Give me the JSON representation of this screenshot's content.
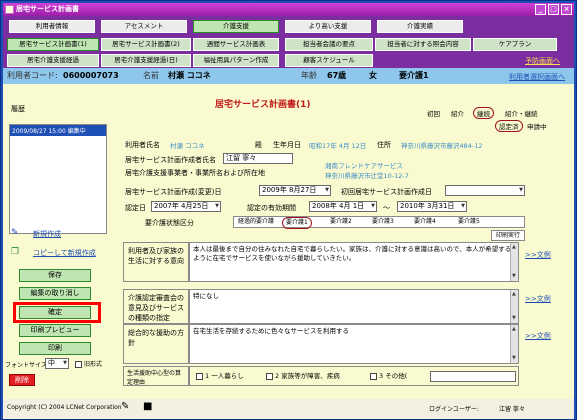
{
  "window": {
    "title": "居宅サービス計画書"
  },
  "nav_row1": [
    "利用者情報",
    "アセスメント",
    "介護支援",
    "より高い支援",
    "介護実績"
  ],
  "nav_row2": [
    "居宅サービス計画書(1)",
    "居宅サービス計画書(2)",
    "週間サービス計画表",
    "担当者会議の要点",
    "担当者に対する照会内容",
    "ケアプラン"
  ],
  "nav_row3": [
    "居宅介護支援経過",
    "居宅介護支援経過(日)",
    "福祉用具パターン作成",
    "顧客スケジュール"
  ],
  "nav_links": {
    "prev_screen": "予防画面へ",
    "user_select": "利用者選択画面へ"
  },
  "info": {
    "code_label": "利用者コード:",
    "code": "0600007073",
    "name_label": "名前",
    "name": "村瀬 ココネ",
    "age_label": "年齢",
    "age": "67歳",
    "sex": "女",
    "care_level": "要介護1"
  },
  "doc_title": "居宅サービス計画書(1)",
  "sidebar": {
    "history_label": "履歴",
    "history_item": "2009/08/27 15:00 編集中",
    "new_link": "新規作成",
    "copy_link": "コピーして新規作成",
    "save": "保存",
    "cancel_edit": "編集の取り消し",
    "confirm": "確定",
    "print_preview": "印刷プレビュー",
    "print": "印刷",
    "font_label": "フォントサイズ",
    "font_value": "中",
    "old_format": "旧形式",
    "delete": "削除"
  },
  "status_badges": {
    "initial": "初回",
    "intro": "紹介",
    "continuing": "継続",
    "intro_continuing": "紹介・継続",
    "certified": "認定済",
    "applying": "申請中"
  },
  "form": {
    "user_name_label": "利用者氏名",
    "user_name": "村瀬 ココネ",
    "honorific": "殿",
    "dob_label": "生年月日",
    "dob": "昭和17年 4月 12日",
    "address_label": "住所",
    "address": "神奈川県藤沢市藤沢484-12",
    "planner_label": "居宅サービス計画作成者氏名",
    "planner": "江留 寧々",
    "office_label": "居宅介護支援事業者・事業所名および所在地",
    "office_name": "湘南フレンドケアサービス",
    "office_address": "神奈川県藤沢市辻堂10-12-7",
    "plan_date_label": "居宅サービス計画作成(変更)日",
    "plan_date": "2009年 8月27日",
    "first_plan_label": "初回居宅サービス計画作成日",
    "first_plan": "",
    "cert_date_label": "認定日",
    "cert_date": "2007年 4月25日",
    "valid_label": "認定の有効期間",
    "valid_from": "2008年 4月 1日",
    "valid_to": "2010年 3月31日",
    "tilde": "～",
    "care_class_label": "要介護状態区分",
    "care_options": [
      "経過的要介護",
      "要介護1",
      "要介護2",
      "要介護3",
      "要介護4",
      "要介護5"
    ],
    "print_label": "印刷実行",
    "intent_label": "利用者及び家族の生活に対する意向",
    "intent_text": "本人は最後まで自分の住みなれた自宅で暮らしたい。家族は、介護に対する意識は高いので、本人が希望するように在宅でサービスを使いながら援助していきたい。",
    "opinion_label": "介護認定審査会の意見及びサービスの種類の指定",
    "opinion_text": "特になし",
    "policy_label": "総合的な援助の方針",
    "policy_text": "在宅生活を存続するために色々なサービスを利用する",
    "example_link": ">>文例",
    "life_support_label": "生活援助中心型の算定理由",
    "life_options": [
      "1 一人暮らし",
      "2 家族等が障害、疾病",
      "3 その他("
    ]
  },
  "status": {
    "copyright": "Copyright (C) 2004 LCNet Corporation",
    "login_label": "ログインユーザー:",
    "login_user": "江留 寧々"
  }
}
